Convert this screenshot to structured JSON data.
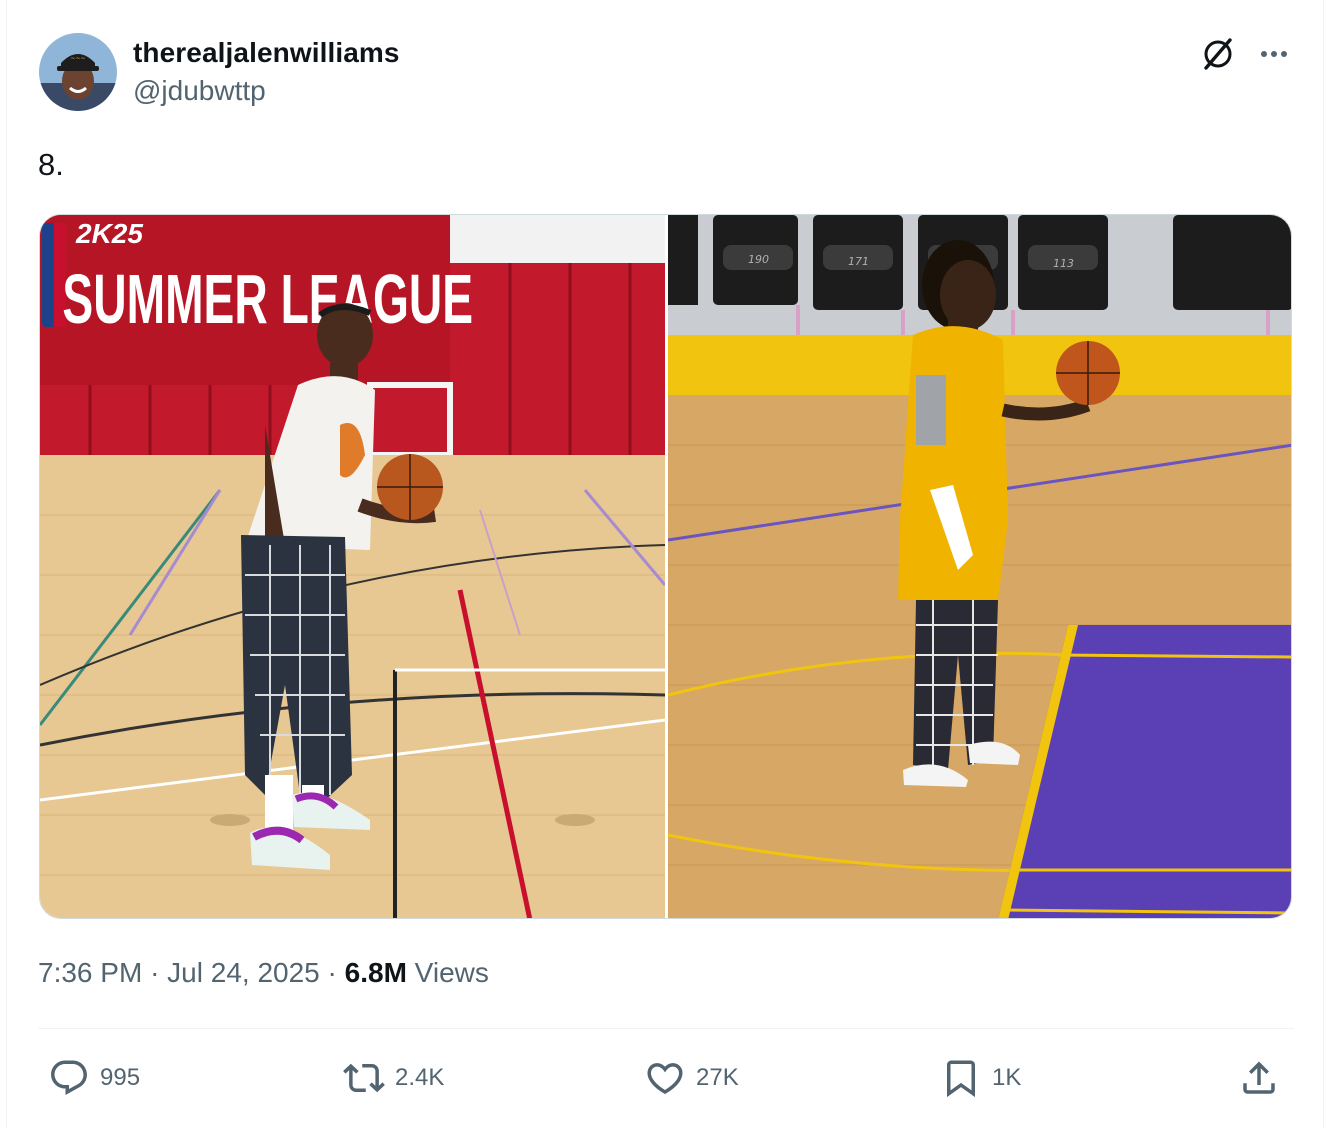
{
  "user": {
    "display_name": "therealjalenwilliams",
    "handle": "@jdubwttp"
  },
  "header_icons": [
    "grok-icon",
    "more-icon"
  ],
  "tweet": {
    "text": "8."
  },
  "media": {
    "left_photo_sign": {
      "brand": "2K25",
      "title": "SUMMER LEAGUE"
    },
    "right_photo_seat_numbers": [
      "190",
      "171",
      "113"
    ]
  },
  "meta": {
    "time": "7:36 PM",
    "sep1": "·",
    "date": "Jul 24, 2025",
    "sep2": "·",
    "views_count": "6.8M",
    "views_label": "Views"
  },
  "actions": {
    "reply": "995",
    "repost": "2.4K",
    "like": "27K",
    "bookmark": "1K"
  },
  "colors": {
    "text_primary": "#0f1419",
    "text_secondary": "#536471",
    "divider": "#eff3f4"
  }
}
